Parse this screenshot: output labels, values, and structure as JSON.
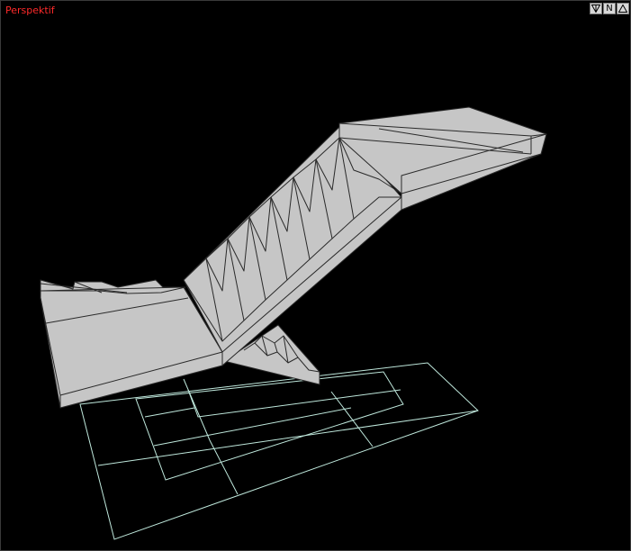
{
  "viewport": {
    "label": "Perspektif",
    "label_color": "#ff2a2a",
    "background": "#000000"
  },
  "view_buttons": [
    {
      "icon": "filter-icon",
      "glyph": "⊽"
    },
    {
      "icon": "n-icon",
      "glyph": "N"
    },
    {
      "icon": "maximize-icon",
      "glyph": "△"
    }
  ],
  "model": {
    "face_color": "#c6c6c6",
    "edge_color": "#2a2a2a",
    "grid_color": "#bfe8dc"
  }
}
